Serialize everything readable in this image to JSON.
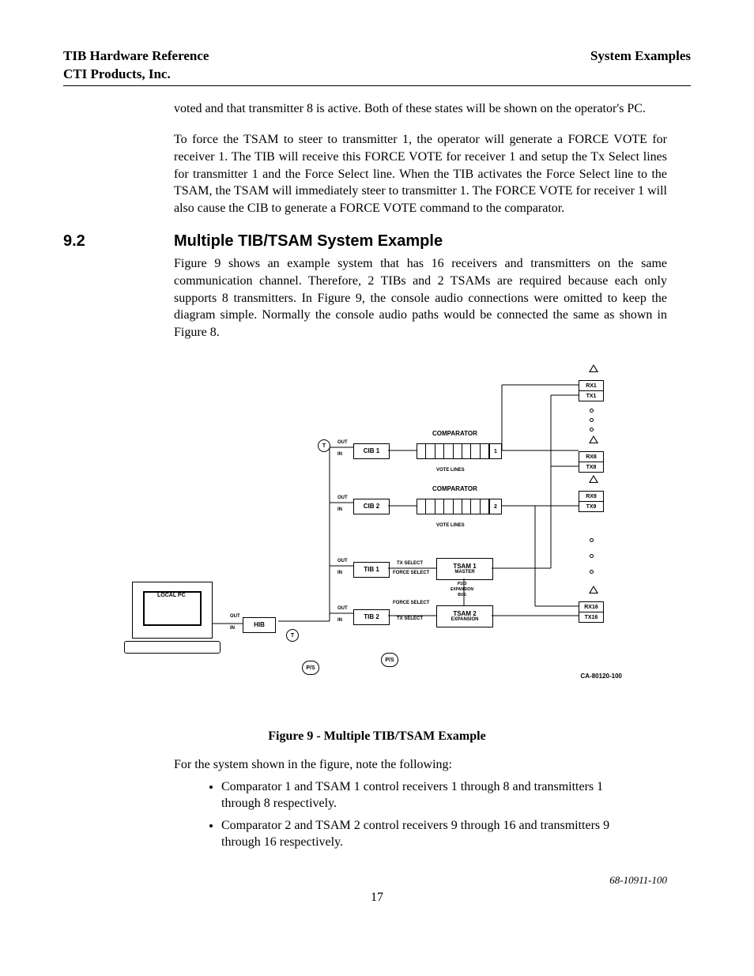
{
  "header": {
    "left_line1": "TIB Hardware Reference",
    "left_line2": "CTI Products, Inc.",
    "right": "System Examples"
  },
  "para1": "voted and that transmitter 8 is active.  Both of these states will be shown on the operator's PC.",
  "para2": "To force the TSAM to steer to transmitter 1, the operator will generate a FORCE VOTE for receiver 1.  The TIB will receive this FORCE VOTE for receiver 1 and setup the Tx Select lines for transmitter 1 and the Force Select line.  When the TIB activates the Force Select line to the TSAM, the TSAM will immediately steer to transmitter 1.  The FORCE VOTE for receiver 1 will also cause the CIB to generate a FORCE VOTE command to the comparator.",
  "section": {
    "num": "9.2",
    "title": "Multiple TIB/TSAM System Example"
  },
  "para3": "Figure 9 shows an example system that has 16 receivers and transmitters on the same communication channel.  Therefore, 2 TIBs and 2 TSAMs are required because each only supports 8 transmitters.  In Figure 9, the console audio connections were omitted to keep the diagram simple.  Normally the console audio paths would be connected the same as shown in Figure 8.",
  "figure": {
    "caption": "Figure 9 - Multiple TIB/TSAM Example",
    "labels": {
      "local_pc": "LOCAL PC",
      "hib": "HIB",
      "cib1": "CIB 1",
      "cib2": "CIB 2",
      "tib1": "TIB 1",
      "tib2": "TIB 2",
      "tsam1": "TSAM 1",
      "tsam1_sub": "MASTER",
      "tsam2": "TSAM 2",
      "tsam2_sub": "EXPANSION",
      "comparator": "COMPARATOR",
      "comp1_num": "1",
      "comp2_num": "2",
      "vote_lines": "VOTE LINES",
      "tx_select": "TX SELECT",
      "force_select": "FORCE SELECT",
      "p103": "P103\nEXPANSION\nBUS",
      "ps": "P/S",
      "t": "T",
      "in": "IN",
      "out": "OUT",
      "rx1": "RX1",
      "tx1": "TX1",
      "rx8": "RX8",
      "tx8": "TX8",
      "rx9": "RX9",
      "tx9": "TX9",
      "rx16": "RX16",
      "tx16": "TX16",
      "drawing_num": "CA-80120-100"
    }
  },
  "para4": "For the system shown in the figure, note the following:",
  "bullets": [
    "Comparator 1 and TSAM 1 control receivers 1 through 8 and transmitters 1 through 8 respectively.",
    "Comparator 2 and TSAM 2 control receivers 9 through 16 and transmitters 9 through 16 respectively."
  ],
  "footer": {
    "docnum": "68-10911-100",
    "page": "17"
  }
}
